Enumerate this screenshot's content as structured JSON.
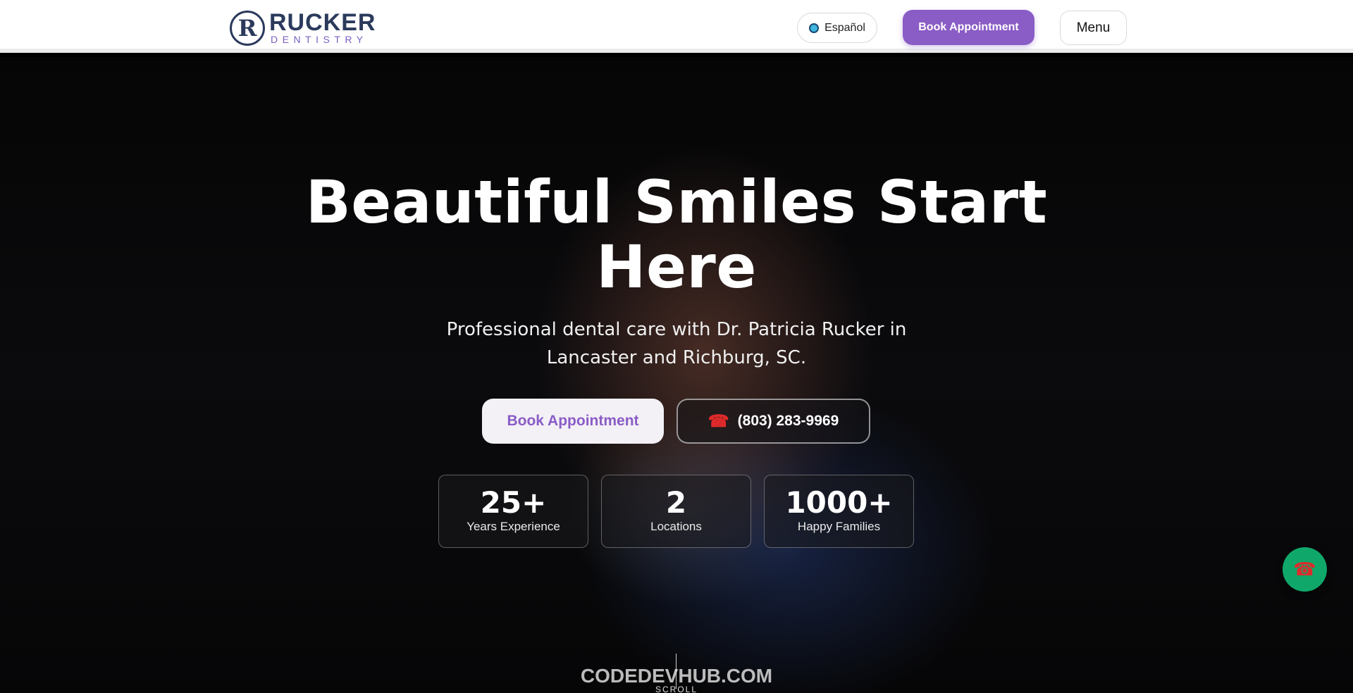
{
  "header": {
    "logo_name": "RUCKER",
    "logo_sub": "DENTISTRY",
    "logo_mark": "R",
    "language_label": "Español",
    "book_label": "Book Appointment",
    "menu_label": "Menu"
  },
  "hero": {
    "title_line1": "Beautiful Smiles Start",
    "title_line2": "Here",
    "subtitle_line1": "Professional dental care with Dr. Patricia Rucker in",
    "subtitle_line2": "Lancaster and Richburg, SC.",
    "book_label": "Book Appointment",
    "phone_label": "(803) 283-9969"
  },
  "stats": [
    {
      "value": "25+",
      "label": "Years Experience"
    },
    {
      "value": "2",
      "label": "Locations"
    },
    {
      "value": "1000+",
      "label": "Happy Families"
    }
  ],
  "scroll_label": "SCROLL",
  "watermark": "CODEDEVHUB.COM",
  "icons": {
    "globe": "globe-icon",
    "phone": "phone-icon",
    "float_call": "phone-icon"
  },
  "colors": {
    "brand_purple": "#8a5cc6",
    "brand_navy": "#2b3a5c",
    "call_green": "#10a86a",
    "phone_red": "#e02a2a"
  }
}
